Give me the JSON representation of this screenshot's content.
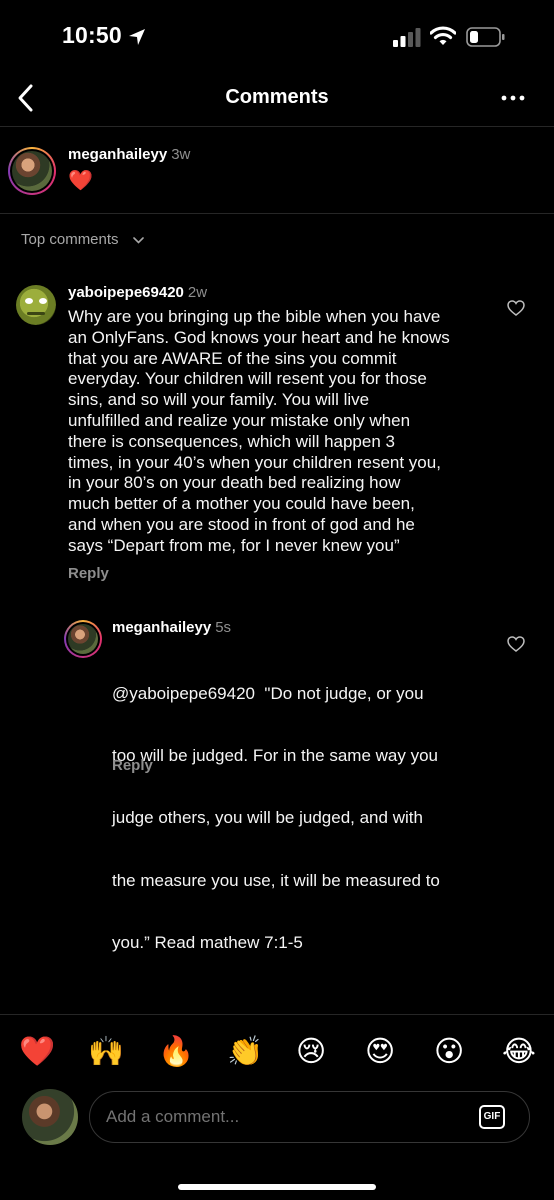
{
  "status_bar": {
    "time": "10:50"
  },
  "header": {
    "title": "Comments"
  },
  "caption": {
    "username": "meganhaileyy",
    "ago": "3w",
    "text": "❤️"
  },
  "sort": {
    "label": "Top comments"
  },
  "comments": [
    {
      "username": "yaboipepe69420",
      "ago": "2w",
      "lines": [
        "Why are you bringing up the bible when you have",
        "an OnlyFans. God knows your heart and he knows",
        "that you are AWARE of the sins you commit",
        "everyday. Your children will resent you for those",
        "sins, and so will your family. You will live",
        "unfulfilled and realize your mistake only when",
        "there is consequences, which will happen 3",
        "times, in your 40’s when your children resent you,",
        "in your 80’s on your death bed realizing how",
        "much better of a mother you could have been,",
        "and when you are stood in front of god and he",
        "says “Depart from me, for I never knew you”"
      ],
      "reply_label": "Reply",
      "replies": [
        {
          "username": "meganhaileyy",
          "ago": "5s",
          "lines": [
            "@yaboipepe69420  \"Do not judge, or you",
            "too will be judged. For in the same way you",
            "judge others, you will be judged, and with",
            "the measure you use, it will be measured to",
            "you.” Read mathew 7:1-5"
          ],
          "reply_label": "Reply"
        }
      ]
    }
  ],
  "reactions": [
    "❤️",
    "🙌",
    "🔥",
    "👏",
    "😢",
    "😍",
    "😮",
    "😂"
  ],
  "composer": {
    "placeholder": "Add a comment...",
    "gif_label": "GIF"
  },
  "colors": {
    "background": "#000000",
    "muted": "#8e8e8e",
    "divider": "#262626"
  }
}
